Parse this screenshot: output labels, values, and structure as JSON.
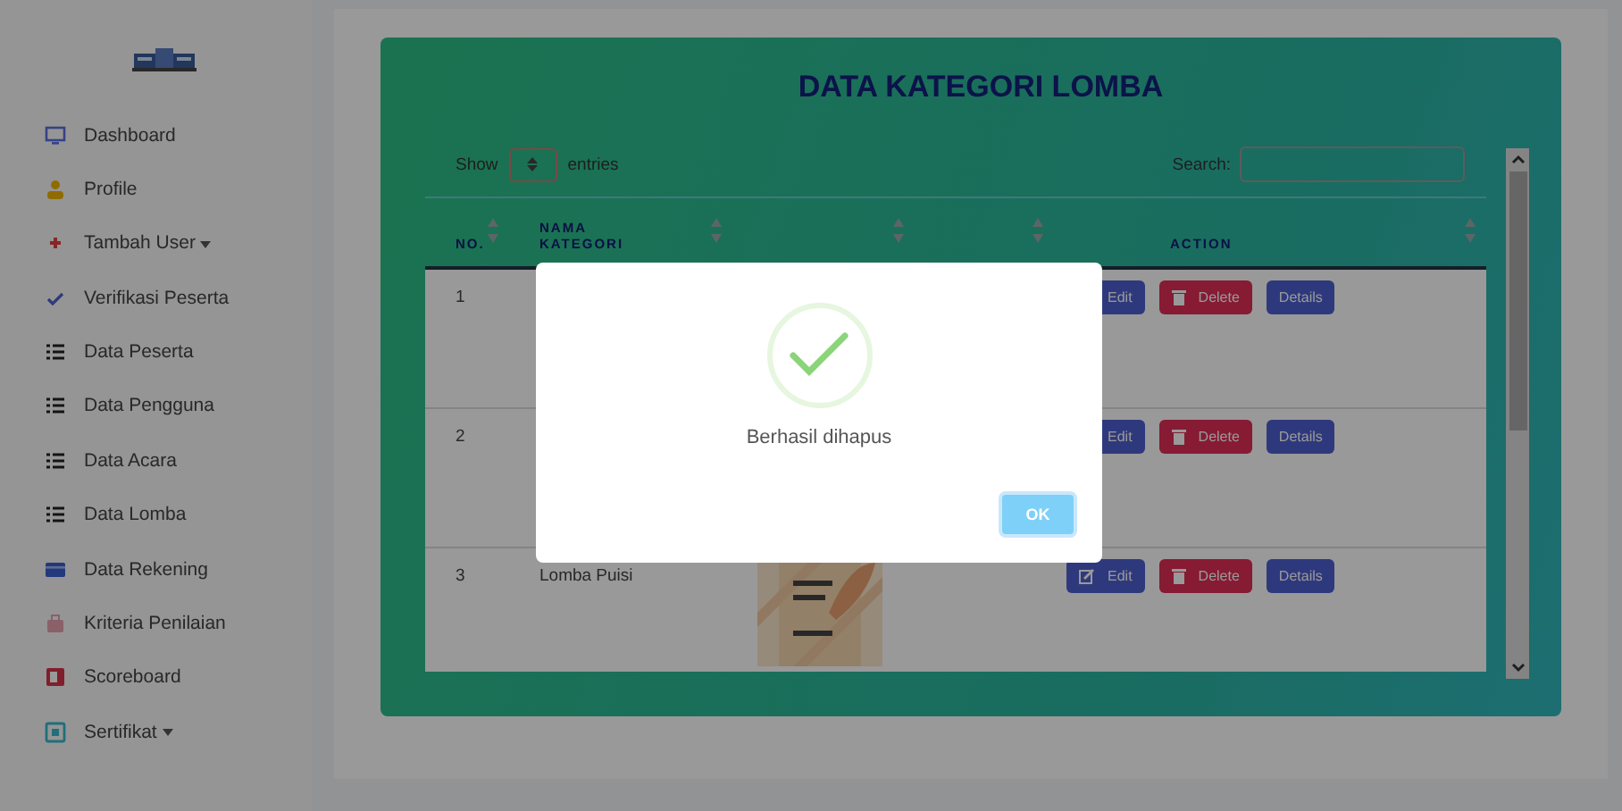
{
  "sidebar": {
    "items": [
      {
        "label": "Dashboard",
        "dropdown": false
      },
      {
        "label": "Profile",
        "dropdown": false
      },
      {
        "label": "Tambah User",
        "dropdown": true
      },
      {
        "label": "Verifikasi Peserta",
        "dropdown": false
      },
      {
        "label": "Data Peserta",
        "dropdown": false
      },
      {
        "label": "Data Pengguna",
        "dropdown": false
      },
      {
        "label": "Data Acara",
        "dropdown": false
      },
      {
        "label": "Data Lomba",
        "dropdown": false
      },
      {
        "label": "Data Rekening",
        "dropdown": false
      },
      {
        "label": "Kriteria Penilaian",
        "dropdown": false
      },
      {
        "label": "Scoreboard",
        "dropdown": false
      },
      {
        "label": "Sertifikat",
        "dropdown": true
      }
    ]
  },
  "card": {
    "title": "DATA KATEGORI LOMBA",
    "show_label": "Show",
    "entries_label": "entries",
    "search_label": "Search:",
    "table": {
      "columns": [
        {
          "label": "NO.",
          "sortable": true
        },
        {
          "label": "NAMA KATEGORI",
          "sortable": true
        },
        {
          "sortable": true
        },
        {
          "sortable": true
        },
        {
          "label": "ACTION",
          "sortable": true
        }
      ],
      "rows": [
        {
          "no": "1",
          "actions": [
            {
              "label": "Edit",
              "kind": "edit"
            },
            {
              "label": "Delete",
              "kind": "delete"
            },
            {
              "label": "Details",
              "kind": "details"
            }
          ]
        },
        {
          "no": "2",
          "actions": [
            {
              "label": "Edit",
              "kind": "edit"
            },
            {
              "label": "Delete",
              "kind": "delete"
            },
            {
              "label": "Details",
              "kind": "details"
            }
          ]
        },
        {
          "no": "3",
          "name": "Lomba Puisi",
          "actions": [
            {
              "label": "Edit",
              "kind": "edit"
            },
            {
              "label": "Delete",
              "kind": "delete"
            },
            {
              "label": "Details",
              "kind": "details"
            }
          ]
        }
      ]
    }
  },
  "dialog": {
    "message": "Berhasil dihapus",
    "button": "OK"
  }
}
